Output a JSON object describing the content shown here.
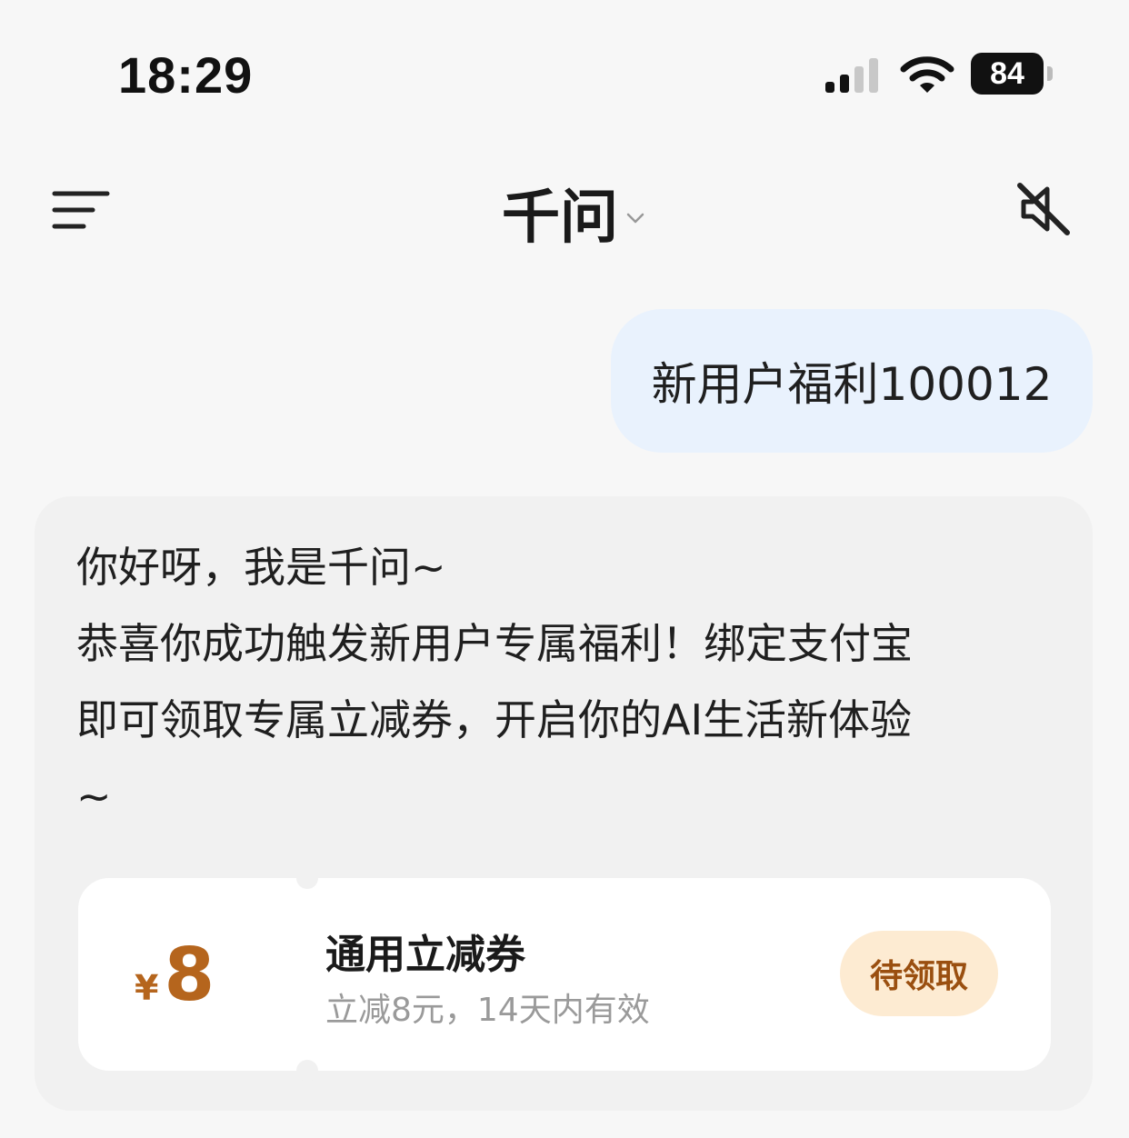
{
  "status_bar": {
    "time": "18:29",
    "battery_level": "84",
    "icons": [
      "signal-icon",
      "wifi-icon",
      "battery-icon"
    ]
  },
  "header": {
    "title": "千问",
    "icons": [
      "menu-icon",
      "chevron-down-icon",
      "mute-icon"
    ]
  },
  "conversation": {
    "user_message": "新用户福利100012",
    "ai_message": "你好呀，我是千问~\n恭喜你成功触发新用户专属福利！绑定支付宝\n即可领取专属立减券，开启你的AI生活新体验\n~"
  },
  "coupon": {
    "currency": "¥",
    "amount": "8",
    "title": "通用立减券",
    "description": "立减8元，14天内有效",
    "button_label": "待领取"
  },
  "colors": {
    "page_background": "#f7f7f7",
    "user_bubble": "#e9f2fd",
    "ai_card": "#f1f1f1",
    "coupon_accent": "#b5651d",
    "claim_button_bg": "#fdebd2",
    "claim_button_text": "#9a4f10"
  }
}
